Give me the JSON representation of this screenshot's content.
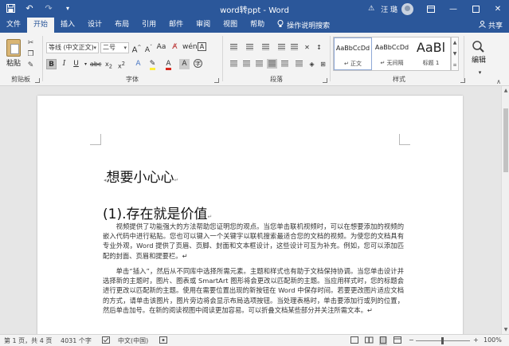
{
  "titlebar": {
    "title": "word转ppt - Word",
    "user": "汪 璐",
    "bg_color": "#2b579a"
  },
  "menu": {
    "tabs": [
      "文件",
      "开始",
      "插入",
      "设计",
      "布局",
      "引用",
      "邮件",
      "审阅",
      "视图",
      "帮助"
    ],
    "active_index": 1,
    "search_label": "操作说明搜索",
    "share_label": "共享"
  },
  "ribbon": {
    "clipboard": {
      "paste": "粘贴",
      "label": "剪贴板"
    },
    "font": {
      "font_name": "等线 (中文正文)",
      "font_size": "二号",
      "label": "字体"
    },
    "paragraph": {
      "label": "段落"
    },
    "styles": {
      "label": "样式",
      "items": [
        {
          "preview": "AaBbCcDd",
          "name": "↵ 正文"
        },
        {
          "preview": "AaBbCcDd",
          "name": "↵ 无间隔"
        },
        {
          "preview": "AaBl",
          "name": "标题 1"
        }
      ]
    },
    "editing": {
      "label": "编辑"
    }
  },
  "document": {
    "heading1": "想要小心心",
    "heading2": "(1).存在就是价值",
    "paragraphs": [
      "视频提供了功能强大的方法帮助您证明您的观点。当您单击联机视频时，可以在想要添加的视频的嵌入代码中进行粘贴。您也可以键入一个关键字以联机搜索最适合您的文档的视频。为使您的文档具有专业外观，Word 提供了页眉、页脚、封面和文本框设计，这些设计可互为补充。例如，您可以添加匹配的封面、页眉和提要栏。↵",
      "单击“插入”，然后从不同库中选择所需元素。主题和样式也有助于文档保持协调。当您单击设计并选择新的主题时，图片、图表或 SmartArt 图形将会更改以匹配新的主题。当应用样式时，您的标题会进行更改以匹配新的主题。使用在需要位置出现的新按钮在 Word 中保存时间。若要更改图片适应文档的方式，请单击该图片，图片旁边将会显示布局选项按钮。当处理表格时，单击要添加行或列的位置，然后单击加号。在新的阅读视图中阅读更加容易。可以折叠文档某些部分并关注所需文本。↵"
    ]
  },
  "status": {
    "page": "第 1 页，共 4 页",
    "words": "4031 个字",
    "language": "中文(中国)",
    "zoom": "100%"
  }
}
